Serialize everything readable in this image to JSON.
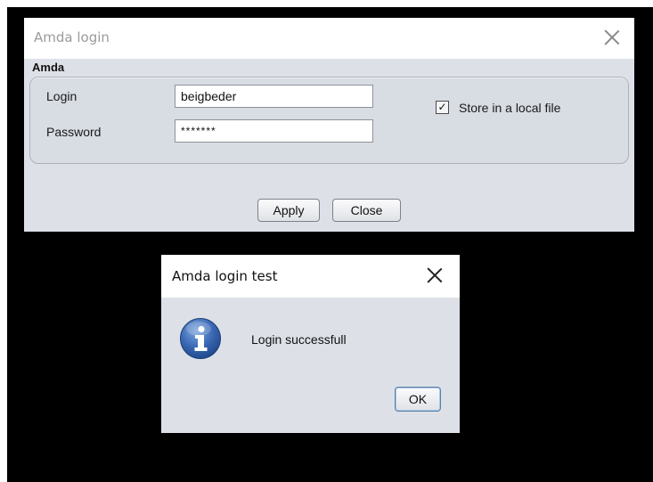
{
  "login_dialog": {
    "title": "Amda login",
    "group_title": "Amda",
    "login_label": "Login",
    "login_value": "beigbeder",
    "password_label": "Password",
    "password_value": "*******",
    "store_checked": true,
    "store_checkmark": "✓",
    "store_label": "Store in a local file",
    "apply_label": "Apply",
    "close_label": "Close"
  },
  "message_dialog": {
    "title": "Amda login test",
    "message": "Login successfull",
    "icon": "info-icon",
    "ok_label": "OK"
  },
  "colors": {
    "dialog_bg": "#dde1e7",
    "backdrop": "#000000",
    "info_icon_blue": "#2e5da8"
  }
}
